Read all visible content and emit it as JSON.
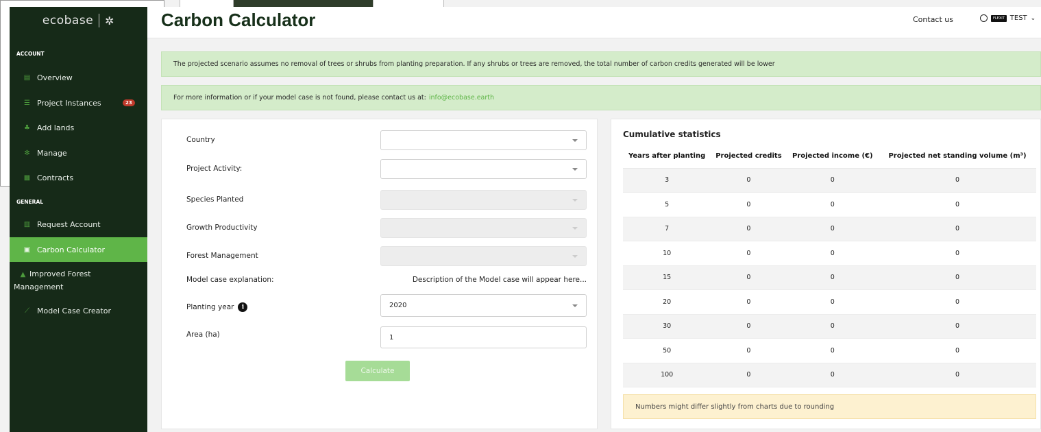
{
  "sidebar": {
    "brand": "ecobase",
    "sections": [
      {
        "title": "ACCOUNT"
      },
      {
        "title": "GENERAL"
      }
    ],
    "items": [
      {
        "label": "Overview",
        "icon": "document-icon"
      },
      {
        "label": "Project Instances",
        "icon": "list-icon",
        "badge": "23"
      },
      {
        "label": "Add lands",
        "icon": "tree-icon"
      },
      {
        "label": "Manage",
        "icon": "gear-icon"
      },
      {
        "label": "Contracts",
        "icon": "file-icon"
      },
      {
        "label": "Request Account",
        "icon": "building-icon"
      },
      {
        "label": "Carbon Calculator",
        "icon": "calculator-icon",
        "active": true
      },
      {
        "label": "Improved Forest",
        "label2": "Management",
        "icon": "forest-icon"
      },
      {
        "label": "Model Case Creator",
        "icon": "chart-line-icon"
      }
    ]
  },
  "header": {
    "title": "Carbon Calculator",
    "contact": "Contact us",
    "user": "TEST",
    "user_tag": "FLEXIT"
  },
  "alerts": {
    "scenario": "The projected scenario assumes no removal of trees or shrubs from planting preparation. If any shrubs or trees are removed, the total number of carbon credits generated will be lower",
    "contact_text": "For more information or if your model case is not found, please contact us at:",
    "contact_email": "info@ecobase.earth"
  },
  "form": {
    "country_label": "Country",
    "country_value": "",
    "activity_label": "Project Activity:",
    "activity_value": "",
    "species_label": "Species Planted",
    "growth_label": "Growth Productivity",
    "management_label": "Forest Management",
    "model_label": "Model case explanation:",
    "model_desc": "Description of the Model case will appear here...",
    "planting_label": "Planting year",
    "planting_value": "2020",
    "area_label": "Area (ha)",
    "area_value": "1",
    "calculate": "Calculate"
  },
  "stats": {
    "title": "Cumulative statistics",
    "columns": [
      "Years after planting",
      "Projected credits",
      "Projected income (€)",
      "Projected net standing volume (m³)"
    ],
    "rows": [
      [
        "3",
        "0",
        "0",
        "0"
      ],
      [
        "5",
        "0",
        "0",
        "0"
      ],
      [
        "7",
        "0",
        "0",
        "0"
      ],
      [
        "10",
        "0",
        "0",
        "0"
      ],
      [
        "15",
        "0",
        "0",
        "0"
      ],
      [
        "20",
        "0",
        "0",
        "0"
      ],
      [
        "30",
        "0",
        "0",
        "0"
      ],
      [
        "50",
        "0",
        "0",
        "0"
      ],
      [
        "100",
        "0",
        "0",
        "0"
      ]
    ],
    "note": "Numbers might differ slightly from charts due to rounding"
  },
  "colors": {
    "sidebar_bg": "#162a18",
    "accent": "#5fb548",
    "alert_bg": "#d4ecca",
    "note_bg": "#fdf1d0"
  }
}
